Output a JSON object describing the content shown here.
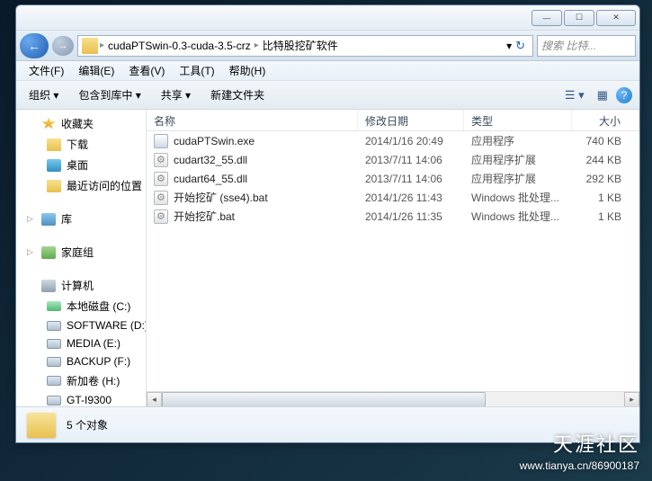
{
  "window": {
    "min": "—",
    "max": "☐",
    "close": "✕"
  },
  "nav": {
    "back": "←",
    "fwd": "→",
    "dropdown": "▾",
    "refresh": "↻"
  },
  "breadcrumb": {
    "seg1": "cudaPTSwin-0.3-cuda-3.5-crz",
    "seg2": "比特股挖矿软件"
  },
  "search": {
    "placeholder": "搜索 比特..."
  },
  "menu": {
    "file": "文件(F)",
    "edit": "编辑(E)",
    "view": "查看(V)",
    "tools": "工具(T)",
    "help": "帮助(H)"
  },
  "toolbar": {
    "organize": "组织 ▾",
    "include": "包含到库中 ▾",
    "share": "共享 ▾",
    "newfolder": "新建文件夹"
  },
  "sidebar": {
    "favorites": "收藏夹",
    "downloads": "下载",
    "desktop": "桌面",
    "recent": "最近访问的位置",
    "libraries": "库",
    "homegroup": "家庭组",
    "computer": "计算机",
    "driveC": "本地磁盘 (C:)",
    "driveD": "SOFTWARE (D:)",
    "driveE": "MEDIA (E:)",
    "driveF": "BACKUP (F:)",
    "driveH": "新加卷 (H:)",
    "gt": "GT-I9300"
  },
  "columns": {
    "name": "名称",
    "date": "修改日期",
    "type": "类型",
    "size": "大小"
  },
  "files": {
    "r0": {
      "name": "cudaPTSwin.exe",
      "date": "2014/1/16 20:49",
      "type": "应用程序",
      "size": "740 KB"
    },
    "r1": {
      "name": "cudart32_55.dll",
      "date": "2013/7/11 14:06",
      "type": "应用程序扩展",
      "size": "244 KB"
    },
    "r2": {
      "name": "cudart64_55.dll",
      "date": "2013/7/11 14:06",
      "type": "应用程序扩展",
      "size": "292 KB"
    },
    "r3": {
      "name": "开始挖矿 (sse4).bat",
      "date": "2014/1/26 11:43",
      "type": "Windows 批处理...",
      "size": "1 KB"
    },
    "r4": {
      "name": "开始挖矿.bat",
      "date": "2014/1/26 11:35",
      "type": "Windows 批处理...",
      "size": "1 KB"
    }
  },
  "status": {
    "text": "5 个对象"
  },
  "watermark": {
    "top": "天涯社区",
    "bot": "www.tianya.cn/86900187"
  }
}
